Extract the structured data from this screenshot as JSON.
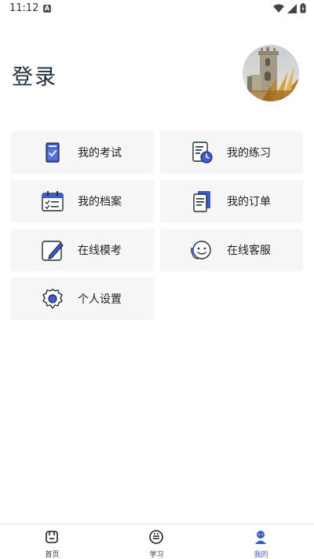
{
  "status_bar": {
    "time": "11:12",
    "notification_glyph": "A"
  },
  "header": {
    "login_label": "登录"
  },
  "menu": [
    {
      "label": "我的考试",
      "icon": "exam-icon"
    },
    {
      "label": "我的练习",
      "icon": "practice-icon"
    },
    {
      "label": "我的档案",
      "icon": "calendar-icon"
    },
    {
      "label": "我的订单",
      "icon": "order-icon"
    },
    {
      "label": "在线模考",
      "icon": "pencil-icon"
    },
    {
      "label": "在线客服",
      "icon": "headset-icon"
    },
    {
      "label": "个人设置",
      "icon": "gear-icon"
    }
  ],
  "tabbar": {
    "tabs": [
      {
        "label": "首页",
        "icon": "home-icon"
      },
      {
        "label": "学习",
        "icon": "study-icon"
      },
      {
        "label": "我的",
        "icon": "profile-icon"
      }
    ],
    "active": "我的"
  },
  "colors": {
    "accent": "#3b5cd6",
    "card_bg": "#f6f6f6",
    "text": "#222222"
  }
}
